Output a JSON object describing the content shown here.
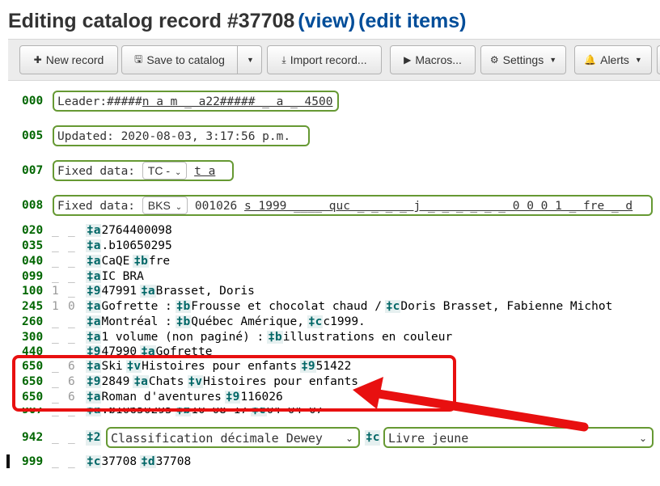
{
  "header": {
    "title": "Editing catalog record #37708",
    "view_link": "(view)",
    "edit_items_link": "(edit items)"
  },
  "toolbar": {
    "new_record": "New record",
    "save": "Save to catalog",
    "import": "Import record...",
    "macros": "Macros...",
    "settings": "Settings",
    "alerts": "Alerts"
  },
  "fields": {
    "f000": {
      "tag": "000",
      "label": "Leader:",
      "value": "#####",
      "underlined": "n a m _ a22##### _ a _ 4500"
    },
    "f005": {
      "tag": "005",
      "label": "Updated: 2020-08-03, 3:17:56 p.m."
    },
    "f007": {
      "tag": "007",
      "label": "Fixed data:",
      "select": "TC -",
      "underlined": "t a"
    },
    "f008": {
      "tag": "008",
      "label": "Fixed data:",
      "select": "BKS",
      "value": "001026",
      "underlined": "s 1999 ____ quc _ _ _ _ j _ _ _ _ _ _ 0 0 0  1 _ fre _ d"
    },
    "f020": {
      "tag": "020",
      "ind1": "_",
      "ind2": "_",
      "c1": "‡a",
      "v1": "2764400098"
    },
    "f035": {
      "tag": "035",
      "ind1": "_",
      "ind2": "_",
      "c1": "‡a",
      "v1": ".b10650295"
    },
    "f040": {
      "tag": "040",
      "ind1": "_",
      "ind2": "_",
      "c1": "‡a",
      "v1": "CaQE",
      "c2": "‡b",
      "v2": "fre"
    },
    "f099": {
      "tag": "099",
      "ind1": "_",
      "ind2": "_",
      "c1": "‡a",
      "v1": "IC BRA"
    },
    "f100": {
      "tag": "100",
      "ind1": "1",
      "ind2": "_",
      "c1": "‡9",
      "v1": "47991",
      "c2": "‡a",
      "v2": "Brasset, Doris"
    },
    "f245": {
      "tag": "245",
      "ind1": "1",
      "ind2": "0",
      "c1": "‡a",
      "v1": "Gofrette :",
      "c2": "‡b",
      "v2": "Frousse et chocolat chaud /",
      "c3": "‡c",
      "v3": "Doris Brasset, Fabienne Michot"
    },
    "f260": {
      "tag": "260",
      "ind1": "_",
      "ind2": "_",
      "c1": "‡a",
      "v1": "Montréal :",
      "c2": "‡b",
      "v2": "Québec Amérique,",
      "c3": "‡c",
      "v3": "c1999."
    },
    "f300": {
      "tag": "300",
      "ind1": "_",
      "ind2": "_",
      "c1": "‡a",
      "v1": "1 volume (non paginé) :",
      "c2": "‡b",
      "v2": "illustrations en couleur"
    },
    "f440": {
      "tag": "440",
      "ind1": "_",
      "ind2": "_",
      "c1": "‡9",
      "v1": "47990",
      "c2": "‡a",
      "v2": "Gofrette"
    },
    "f650a": {
      "tag": "650",
      "ind1": "_",
      "ind2": "6",
      "c1": "‡a",
      "v1": "Ski",
      "c2": "‡v",
      "v2": "Histoires pour enfants",
      "c3": "‡9",
      "v3": "51422"
    },
    "f650b": {
      "tag": "650",
      "ind1": "_",
      "ind2": "6",
      "c1": "‡9",
      "v1": "2849",
      "c2": "‡a",
      "v2": "Chats",
      "c3": "‡v",
      "v3": "Histoires pour enfants"
    },
    "f650c": {
      "tag": "650",
      "ind1": "_",
      "ind2": "6",
      "c1": "‡a",
      "v1": "Roman d'aventures",
      "c2": "‡9",
      "v2": "116026"
    },
    "f907": {
      "tag": "907",
      "ind1": "_",
      "ind2": "_",
      "c1": "‡a",
      "v1": ".b10650295",
      "c2": "‡b",
      "v2": "10-08-17",
      "c3": "‡c",
      "v3": "04-04-07"
    },
    "f942": {
      "tag": "942",
      "ind1": "_",
      "ind2": "_",
      "c1": "‡2",
      "select1": "Classification décimale Dewey",
      "c2": "‡c",
      "select2": "Livre jeune"
    },
    "f999": {
      "tag": "999",
      "ind1": "_",
      "ind2": "_",
      "c1": "‡c",
      "v1": "37708",
      "c2": "‡d",
      "v2": "37708"
    }
  },
  "annotation": {
    "color": "#e81010"
  },
  "icons": [
    "plus-icon",
    "save-icon",
    "import-icon",
    "play-icon",
    "gear-icon",
    "bell-icon",
    "caret-down-icon"
  ]
}
